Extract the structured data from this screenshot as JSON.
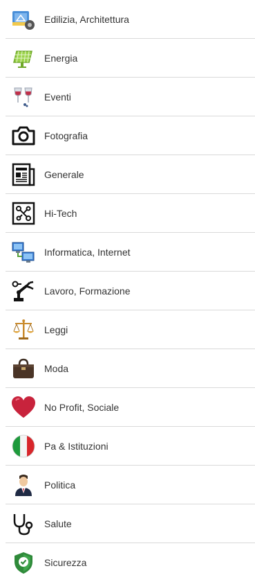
{
  "categories": [
    {
      "label": "Edilizia, Architettura",
      "icon": "architecture-icon"
    },
    {
      "label": "Energia",
      "icon": "solar-panel-icon"
    },
    {
      "label": "Eventi",
      "icon": "wine-glasses-icon"
    },
    {
      "label": "Fotografia",
      "icon": "camera-icon"
    },
    {
      "label": "Generale",
      "icon": "newspaper-icon"
    },
    {
      "label": "Hi-Tech",
      "icon": "circuit-icon"
    },
    {
      "label": "Informatica, Internet",
      "icon": "network-computers-icon"
    },
    {
      "label": "Lavoro, Formazione",
      "icon": "robot-arm-icon"
    },
    {
      "label": "Leggi",
      "icon": "scales-icon"
    },
    {
      "label": "Moda",
      "icon": "handbag-icon"
    },
    {
      "label": "No Profit, Sociale",
      "icon": "heart-icon"
    },
    {
      "label": "Pa & Istituzioni",
      "icon": "italian-flag-icon"
    },
    {
      "label": "Politica",
      "icon": "politician-icon"
    },
    {
      "label": "Salute",
      "icon": "stethoscope-icon"
    },
    {
      "label": "Sicurezza",
      "icon": "shield-icon"
    }
  ]
}
